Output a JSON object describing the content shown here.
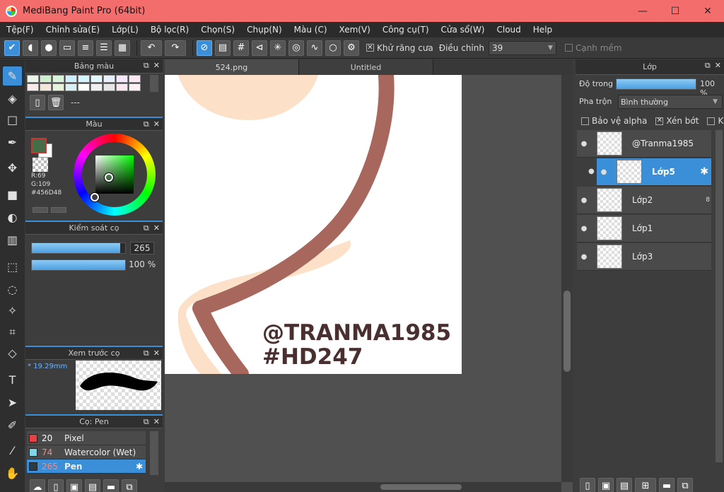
{
  "window": {
    "title": "MediBang Paint Pro (64bit)",
    "minimize": "—",
    "maximize": "☐",
    "close": "✕"
  },
  "menu": [
    "Tệp(F)",
    "Chỉnh sửa(E)",
    "Lớp(L)",
    "Bộ lọc(R)",
    "Chọn(S)",
    "Chụp(N)",
    "Màu (C)",
    "Xem(V)",
    "Công cụ(T)",
    "Cửa sổ(W)",
    "Cloud",
    "Help"
  ],
  "toolbar": {
    "antialias_label": "Khử răng cưa",
    "antialias_checked": "✕",
    "adjust_label": "Điều chỉnh",
    "adjust_value": "39",
    "soft_edge_label": "Cạnh mềm"
  },
  "palette_panel": {
    "title": "Bảng màu",
    "palette_name": "---",
    "swatches": [
      "#e8f7e8",
      "#ccf0cc",
      "#d8f5d8",
      "#ccefff",
      "#d4f4ff",
      "#e0f8ff",
      "#e6f0ff",
      "#f4e6ff",
      "#fbe6f2",
      "#fbeaea",
      "#f6e6d9",
      "#e6f4d9",
      "#d9f0f4",
      "#ffffff",
      "#f0f0f0",
      "#e6e6e6",
      "#ffe6f0",
      "#fff0f6"
    ]
  },
  "color_panel": {
    "title": "Màu",
    "r_label": "R:69",
    "g_label": "G:109",
    "hex_label": "#456D48",
    "foreground": "#456d48",
    "background": "#ffffff"
  },
  "brush_control": {
    "title": "Kiểm soát cọ",
    "size_value": "265",
    "size_fraction": 0.95,
    "opacity_value": "100 %",
    "opacity_fraction": 1.0
  },
  "brush_preview": {
    "title": "Xem trước cọ",
    "size_label": "19.29mm",
    "size_marker": "*"
  },
  "brush_panel": {
    "title": "Cọ: Pen",
    "items": [
      {
        "size": "20",
        "name": "Pixel",
        "color": "#e84141"
      },
      {
        "size": "74",
        "name": "Watercolor (Wet)",
        "color": "#7fd6e8"
      },
      {
        "size": "265",
        "name": "Pen",
        "color": "#2c3a44",
        "selected": true
      }
    ]
  },
  "tabs": [
    "524.png",
    "Untitled"
  ],
  "canvas": {
    "watermark_line1": "@TRANMA1985",
    "watermark_line2": "#HD247"
  },
  "layer_panel": {
    "title": "Lớp",
    "opacity_label": "Độ trong",
    "opacity_value": "100 %",
    "opacity_fraction": 1.0,
    "blend_label": "Pha trộn",
    "blend_value": "Bình thường",
    "protect_alpha": "Bảo vệ alpha",
    "clipping": "Xén bớt",
    "clipping_mark": "✕",
    "lock": "Khóa",
    "layers": [
      {
        "name": "@Tranma1985"
      },
      {
        "name": "Lớp5",
        "selected": true
      },
      {
        "name": "Lớp2",
        "badge": "8"
      },
      {
        "name": "Lớp1"
      },
      {
        "name": "Lớp3"
      }
    ]
  },
  "icons": {
    "eye": "●",
    "gear": "✱"
  }
}
